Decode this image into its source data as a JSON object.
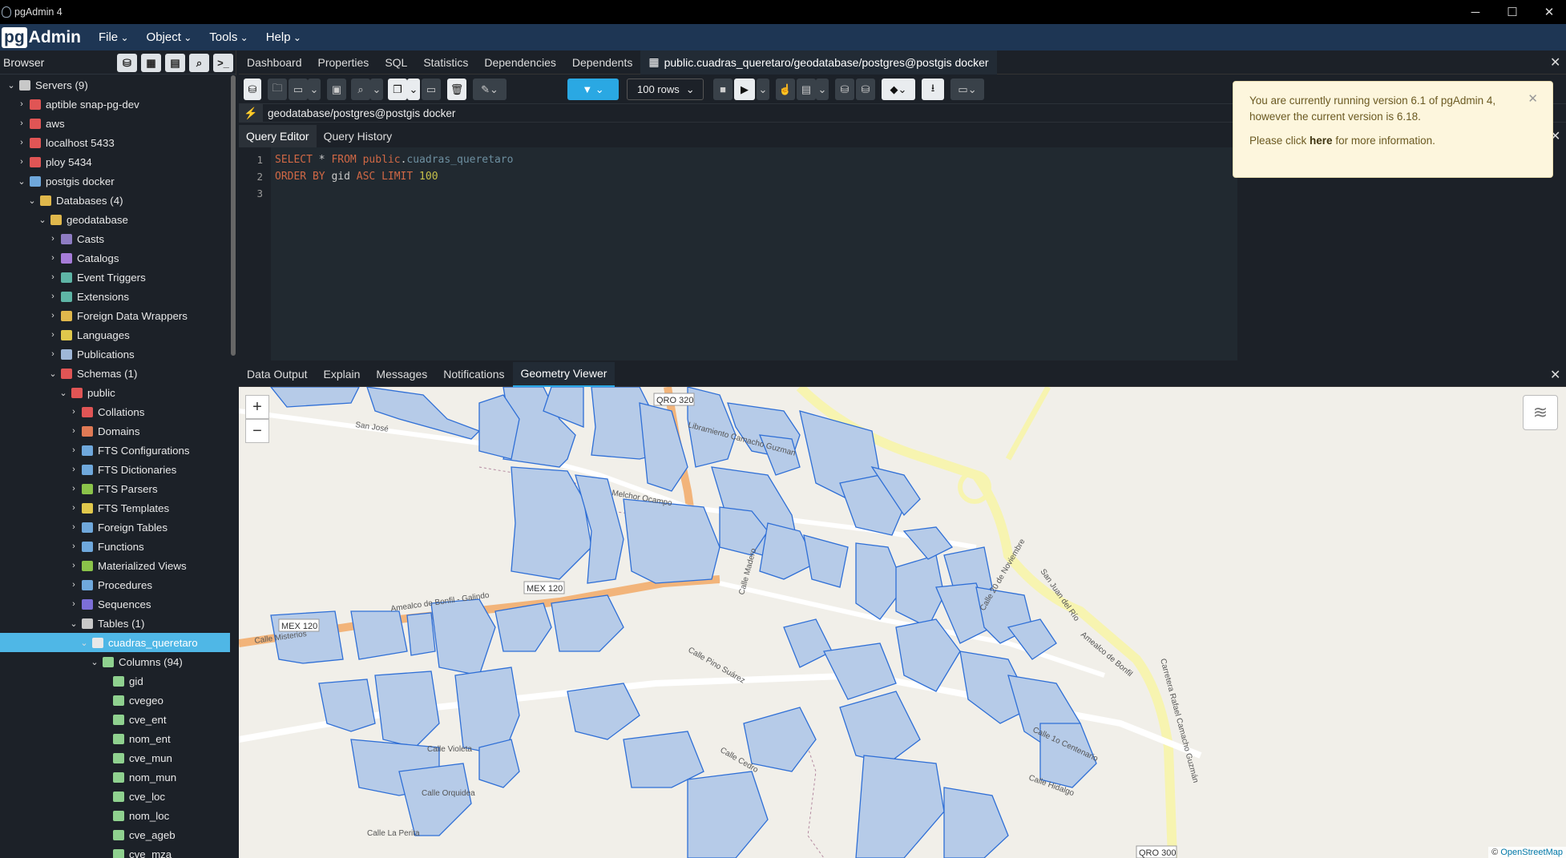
{
  "window": {
    "title": "pgAdmin 4"
  },
  "menu": {
    "brand_pg": "pg",
    "brand_admin": "Admin",
    "items": [
      "File",
      "Object",
      "Tools",
      "Help"
    ]
  },
  "browser": {
    "title": "Browser",
    "tree": [
      {
        "label": "Servers (9)",
        "icon_color": "#c8c8c8",
        "icon": "servers-icon"
      },
      {
        "label": "aptible snap-pg-dev",
        "icon_color": "#e05555",
        "icon": "server-icon"
      },
      {
        "label": "aws",
        "icon_color": "#e05555",
        "icon": "server-icon"
      },
      {
        "label": "localhost 5433",
        "icon_color": "#e05555",
        "icon": "server-icon"
      },
      {
        "label": "ploy 5434",
        "icon_color": "#e05555",
        "icon": "server-icon"
      },
      {
        "label": "postgis docker",
        "icon_color": "#6fa8dc",
        "icon": "elephant-icon"
      },
      {
        "label": "Databases (4)",
        "icon_color": "#e0b84c",
        "icon": "databases-icon"
      },
      {
        "label": "geodatabase",
        "icon_color": "#e0b84c",
        "icon": "database-icon"
      },
      {
        "label": "Casts",
        "icon_color": "#8e7cc3",
        "icon": "casts-icon"
      },
      {
        "label": "Catalogs",
        "icon_color": "#a67cd8",
        "icon": "catalogs-icon"
      },
      {
        "label": "Event Triggers",
        "icon_color": "#5eb5a6",
        "icon": "event-triggers-icon"
      },
      {
        "label": "Extensions",
        "icon_color": "#5eb5a6",
        "icon": "extensions-icon"
      },
      {
        "label": "Foreign Data Wrappers",
        "icon_color": "#e0b84c",
        "icon": "fdw-icon"
      },
      {
        "label": "Languages",
        "icon_color": "#e0c84c",
        "icon": "languages-icon"
      },
      {
        "label": "Publications",
        "icon_color": "#9fb7d8",
        "icon": "publications-icon"
      },
      {
        "label": "Schemas (1)",
        "icon_color": "#e05555",
        "icon": "schemas-icon"
      },
      {
        "label": "public",
        "icon_color": "#e05555",
        "icon": "schema-icon"
      },
      {
        "label": "Collations",
        "icon_color": "#e05555",
        "icon": "collations-icon"
      },
      {
        "label": "Domains",
        "icon_color": "#e07a55",
        "icon": "domains-icon"
      },
      {
        "label": "FTS Configurations",
        "icon_color": "#6fa8dc",
        "icon": "fts-config-icon"
      },
      {
        "label": "FTS Dictionaries",
        "icon_color": "#6fa8dc",
        "icon": "fts-dict-icon"
      },
      {
        "label": "FTS Parsers",
        "icon_color": "#8bc34a",
        "icon": "fts-parsers-icon"
      },
      {
        "label": "FTS Templates",
        "icon_color": "#e0c84c",
        "icon": "fts-templates-icon"
      },
      {
        "label": "Foreign Tables",
        "icon_color": "#6fa8dc",
        "icon": "foreign-tables-icon"
      },
      {
        "label": "Functions",
        "icon_color": "#6fa8dc",
        "icon": "functions-icon"
      },
      {
        "label": "Materialized Views",
        "icon_color": "#8bc34a",
        "icon": "mat-views-icon"
      },
      {
        "label": "Procedures",
        "icon_color": "#6fa8dc",
        "icon": "procedures-icon"
      },
      {
        "label": "Sequences",
        "icon_color": "#7c6fd8",
        "icon": "sequences-icon"
      },
      {
        "label": "Tables (1)",
        "icon_color": "#c8c8c8",
        "icon": "tables-icon"
      },
      {
        "label": "cuadras_queretaro",
        "icon_color": "#e8e8e8",
        "icon": "table-icon"
      },
      {
        "label": "Columns (94)",
        "icon_color": "#8fd18f",
        "icon": "columns-icon"
      },
      {
        "label": "gid",
        "icon_color": "#8fd18f",
        "icon": "column-icon"
      },
      {
        "label": "cvegeo",
        "icon_color": "#8fd18f",
        "icon": "column-icon"
      },
      {
        "label": "cve_ent",
        "icon_color": "#8fd18f",
        "icon": "column-icon"
      },
      {
        "label": "nom_ent",
        "icon_color": "#8fd18f",
        "icon": "column-icon"
      },
      {
        "label": "cve_mun",
        "icon_color": "#8fd18f",
        "icon": "column-icon"
      },
      {
        "label": "nom_mun",
        "icon_color": "#8fd18f",
        "icon": "column-icon"
      },
      {
        "label": "cve_loc",
        "icon_color": "#8fd18f",
        "icon": "column-icon"
      },
      {
        "label": "nom_loc",
        "icon_color": "#8fd18f",
        "icon": "column-icon"
      },
      {
        "label": "cve_ageb",
        "icon_color": "#8fd18f",
        "icon": "column-icon"
      },
      {
        "label": "cve_mza",
        "icon_color": "#8fd18f",
        "icon": "column-icon"
      }
    ]
  },
  "tabs": [
    "Dashboard",
    "Properties",
    "SQL",
    "Statistics",
    "Dependencies",
    "Dependents",
    "public.cuadras_queretaro/geodatabase/postgres@postgis docker"
  ],
  "toolbar": {
    "rows_select": "100 rows"
  },
  "connection": {
    "value": "geodatabase/postgres@postgis docker"
  },
  "query_tabs": [
    "Query Editor",
    "Query History"
  ],
  "editor": {
    "line_numbers": [
      "1",
      "2",
      "3"
    ],
    "line1": {
      "kw1": "SELECT",
      "star": " * ",
      "kw2": "FROM",
      "schema": " public",
      "dot": ".",
      "table": "cuadras_queretaro"
    },
    "line2": {
      "kw1": "ORDER BY",
      "col": " gid ",
      "kw2": "ASC LIMIT",
      "num": " 100"
    }
  },
  "result_tabs": [
    "Data Output",
    "Explain",
    "Messages",
    "Notifications",
    "Geometry Viewer"
  ],
  "toast": {
    "line1": "You are currently running version 6.1 of pgAdmin 4,",
    "line2": "however the current version is 6.18.",
    "please": "Please click ",
    "link": "here",
    "rest": " for more information."
  },
  "map": {
    "zoom_in": "+",
    "zoom_out": "−",
    "attribution_prefix": "© ",
    "attribution_link": "OpenStreetMap",
    "road_labels": {
      "qro320": "QRO 320",
      "mex120a": "MEX 120",
      "mex120b": "MEX 120",
      "qro300": "QRO 300",
      "libramiento": "Libramiento Camacho Guzman",
      "amealco": "Amealco de Bonfil - Galindo",
      "amealco_se": "Amealco de Bonfil",
      "carretera": "Carretera Rafael Camacho Guzmán",
      "misterios": "Calle Misterios",
      "madero": "Calle Madero",
      "perita": "Calle La Perita",
      "orquidea": "Calle Orquidea",
      "pino": "Calle Pino Suárez",
      "hidalgo": "Calle Hidalgo",
      "sanjose": "San José",
      "melchor": "Melchor Ocampo",
      "violeta": "Calle Violeta",
      "centenario": "Calle 1o Centenario",
      "nov20": "Calle 20 de Noviembre",
      "sanjuan": "San Juan del Río",
      "cedro": "Calle Cedro"
    }
  }
}
